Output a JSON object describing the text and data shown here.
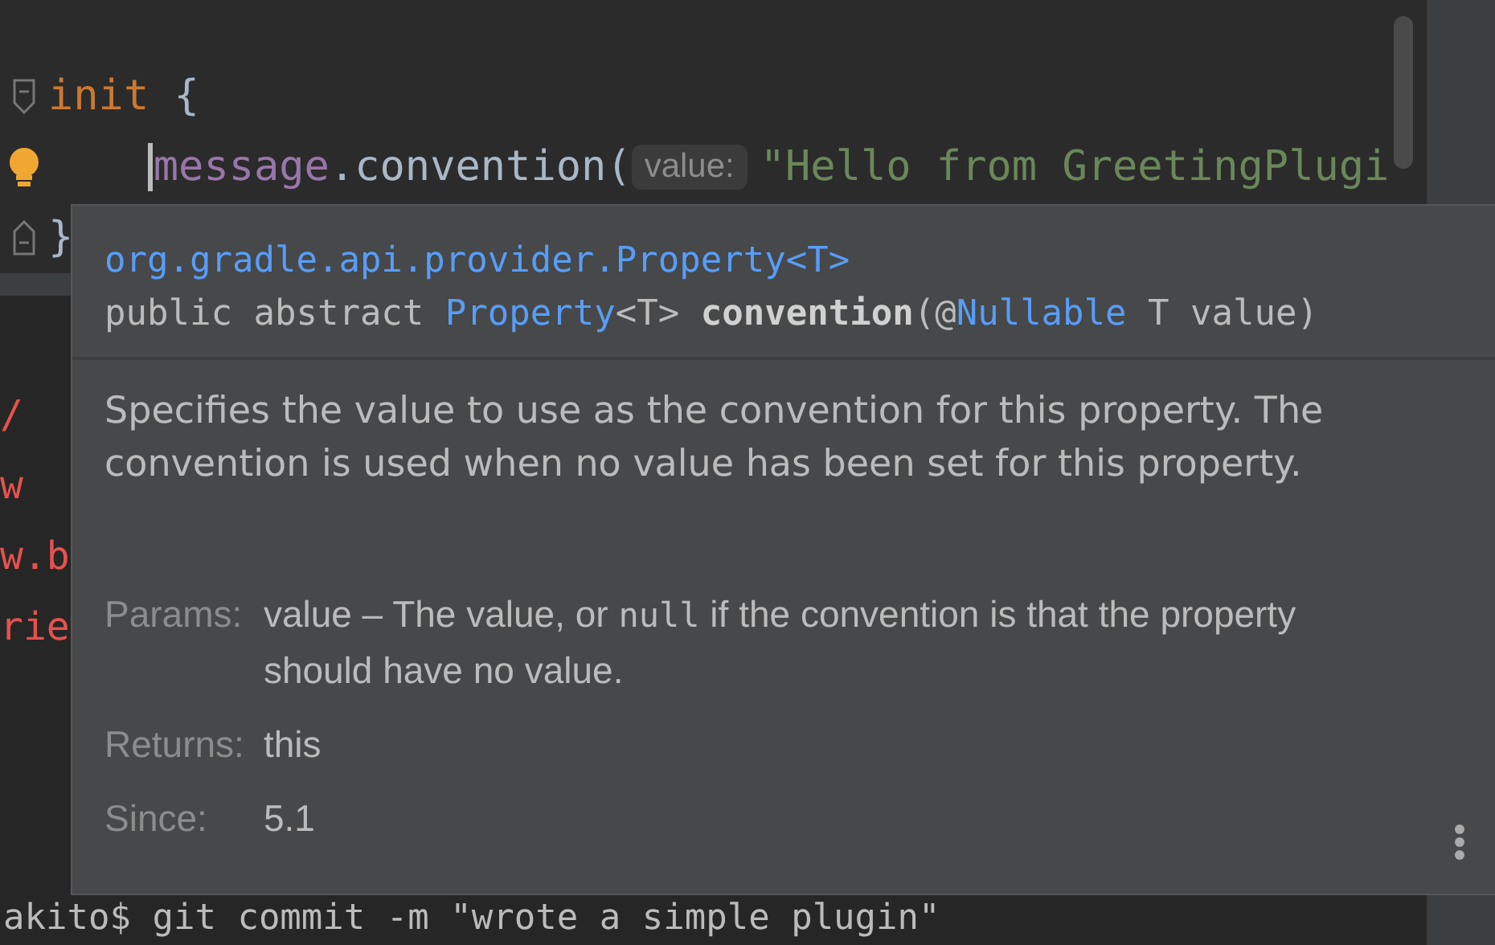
{
  "editor": {
    "lines": [
      {
        "gutter_icon": {
          "kind": "fold_start"
        },
        "caret": false,
        "tokens": [
          {
            "kind": "keyword",
            "text": "init"
          },
          {
            "kind": "plain",
            "text": " {"
          }
        ]
      },
      {
        "gutter_icon": {
          "kind": "bulb"
        },
        "caret": true,
        "tokens": [
          {
            "kind": "field",
            "text": "message"
          },
          {
            "kind": "plain",
            "text": ".convention("
          },
          {
            "kind": "hint",
            "text": "value:"
          },
          {
            "kind": "string",
            "text": "\"Hello from GreetingPlugi"
          }
        ]
      },
      {
        "gutter_icon": {
          "kind": "fold_end"
        },
        "caret": false,
        "tokens": [
          {
            "kind": "plain",
            "text": "}"
          }
        ]
      }
    ]
  },
  "terminal": {
    "lines": [
      {
        "kind": "error",
        "text": "/"
      },
      {
        "kind": "error",
        "text": "w"
      },
      {
        "kind": "error",
        "text": "w.b"
      },
      {
        "kind": "error",
        "text": "rie"
      }
    ],
    "prompt": "akito$ git commit -m \"wrote a simple plugin\""
  },
  "doc_popup": {
    "qualified_name": "org.gradle.api.provider.Property<T>",
    "signature": [
      {
        "kind": "plain",
        "text": "public abstract "
      },
      {
        "kind": "link",
        "text": "Property"
      },
      {
        "kind": "plain",
        "text": "<T> "
      },
      {
        "kind": "bold",
        "text": "convention"
      },
      {
        "kind": "plain",
        "text": "(@"
      },
      {
        "kind": "link",
        "text": "Nullable"
      },
      {
        "kind": "plain",
        "text": " T value)"
      }
    ],
    "description": "Specifies the value to use as the convention for this property. The convention is used when no value has been set for this property.",
    "sections": [
      {
        "label": "Params:",
        "content": [
          {
            "kind": "text",
            "text": "value – The value, or "
          },
          {
            "kind": "code",
            "text": "null"
          },
          {
            "kind": "text",
            "text": " if the convention is that the property should have no value."
          }
        ]
      },
      {
        "label": "Returns:",
        "content": [
          {
            "kind": "text",
            "text": "this"
          }
        ]
      },
      {
        "label": "Since:",
        "content": [
          {
            "kind": "text",
            "text": "5.1"
          }
        ]
      }
    ]
  }
}
